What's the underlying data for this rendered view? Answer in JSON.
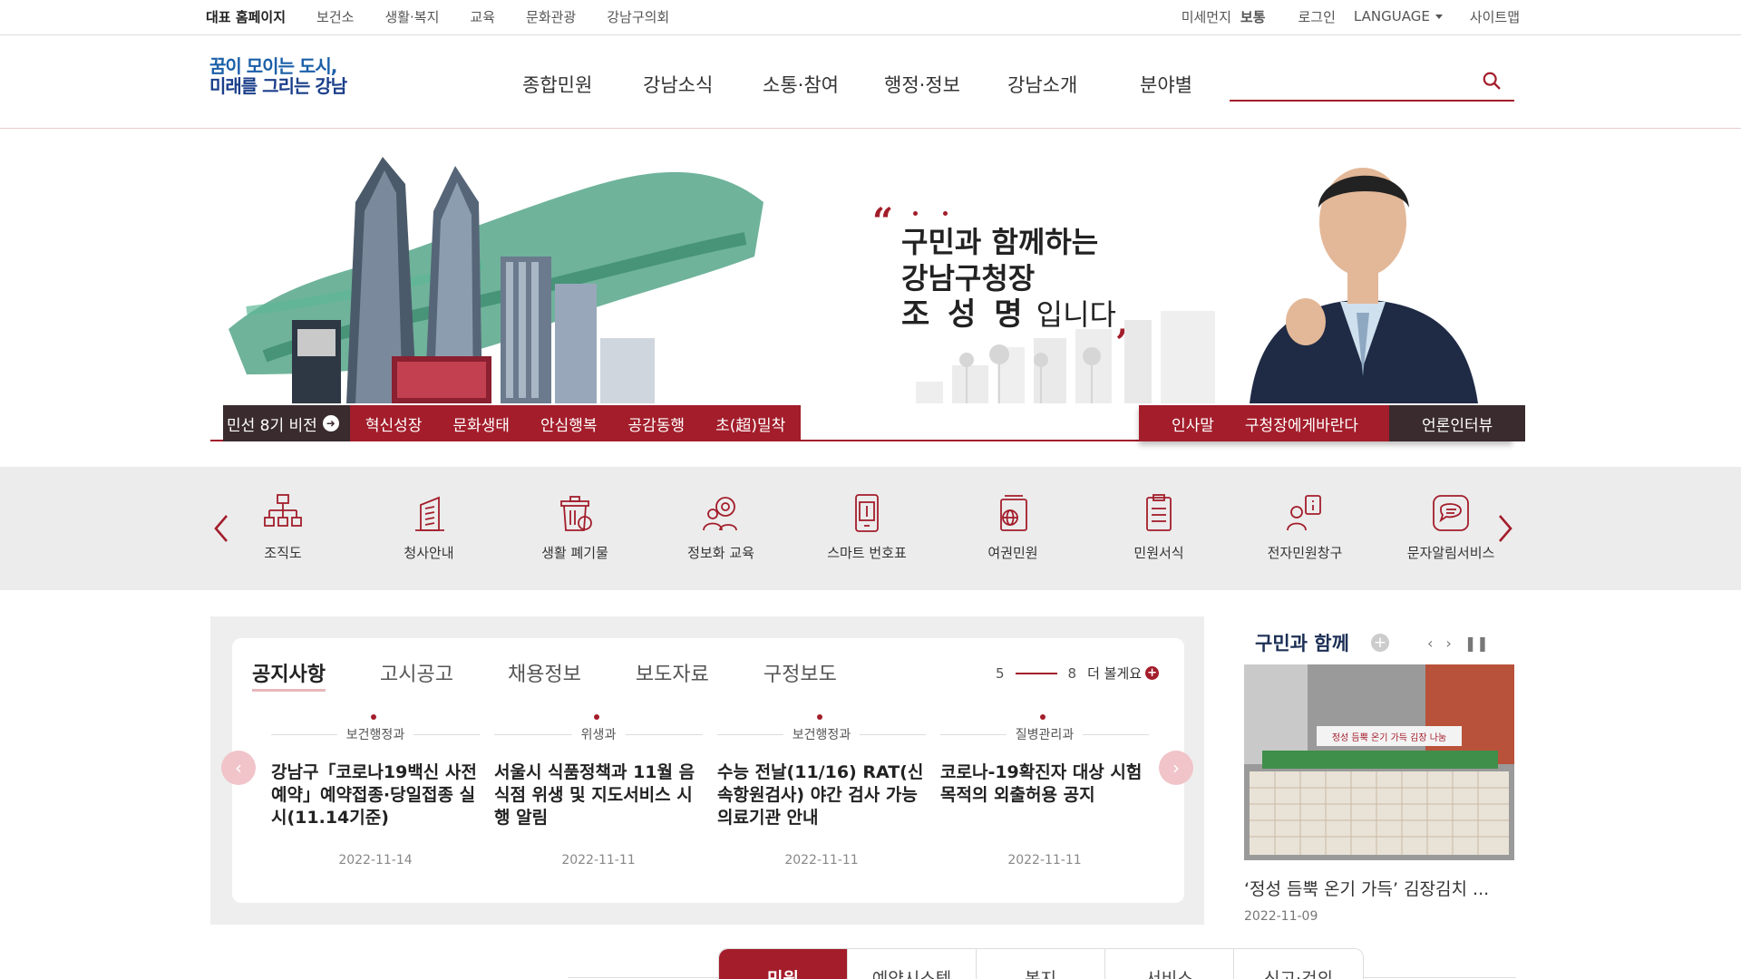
{
  "topbar": {
    "left_links": [
      "대표 홈페이지",
      "보건소",
      "생활·복지",
      "교육",
      "문화관광",
      "강남구의회"
    ],
    "dust_label": "미세먼지",
    "dust_value": "보통",
    "login": "로그인",
    "language": "LANGUAGE",
    "sitemap": "사이트맵"
  },
  "header": {
    "logo_line1": "꿈이 모이는 도시,",
    "logo_line2": "미래를 그리는 강남",
    "gnb": [
      "종합민원",
      "강남소식",
      "소통·참여",
      "행정·정보",
      "강남소개",
      "분야별"
    ],
    "search_placeholder": ""
  },
  "hero": {
    "quote_line1": "구민과 함께하는",
    "quote_line2": "강남구청장",
    "quote_name": "조 성 명",
    "quote_suffix": "입니다",
    "vision_first": "민선 8기 비전",
    "vision_items": [
      "혁신성장",
      "문화생태",
      "안심행복",
      "공감동행",
      "초(超)밀착"
    ],
    "mayor_links": [
      "인사말",
      "구청장에게바란다",
      "언론인터뷰"
    ]
  },
  "quick_menu": [
    {
      "label": "조직도",
      "icon": "org-chart-icon"
    },
    {
      "label": "청사안내",
      "icon": "building-icon"
    },
    {
      "label": "생활 폐기물",
      "icon": "trash-icon"
    },
    {
      "label": "정보화 교육",
      "icon": "gear-people-icon"
    },
    {
      "label": "스마트 번호표",
      "icon": "number-ticket-icon"
    },
    {
      "label": "여권민원",
      "icon": "passport-icon"
    },
    {
      "label": "민원서식",
      "icon": "form-icon"
    },
    {
      "label": "전자민원창구",
      "icon": "e-service-icon"
    },
    {
      "label": "문자알림서비스",
      "icon": "sms-icon"
    }
  ],
  "board": {
    "tabs": [
      "공지사항",
      "고시공고",
      "채용정보",
      "보도자료",
      "구정보도"
    ],
    "active_tab": 0,
    "page_current": "5",
    "page_total": "8",
    "more_label": "더 볼게요",
    "notices": [
      {
        "dept": "보건행정과",
        "title": "강남구「코로나19백신 사전예약」예약접종·당일접종 실시(11.14기준)",
        "date": "2022-11-14"
      },
      {
        "dept": "위생과",
        "title": "서울시 식품정책과 11월 음식점 위생 및 지도서비스 시행 알림",
        "date": "2022-11-11"
      },
      {
        "dept": "보건행정과",
        "title": "수능 전날(11/16) RAT(신속항원검사) 야간 검사 가능 의료기관 안내",
        "date": "2022-11-11"
      },
      {
        "dept": "질병관리과",
        "title": "코로나-19확진자 대상 시험목적의 외출허용 공지",
        "date": "2022-11-11"
      }
    ]
  },
  "together": {
    "title": "구민과 함께",
    "caption": "‘정성 듬뿍 온기 가득’ 김장김치 ...",
    "date": "2022-11-09",
    "banner_text": "정성 듬뿍 온기 가득 김장 나눔"
  },
  "bottom_tabs": [
    "민원",
    "예약시스템",
    "복지",
    "서비스",
    "신고·건의"
  ],
  "colors": {
    "accent": "#a31d2b",
    "dark": "#3a2b2e",
    "good": "#19a05a",
    "navy": "#1c2f55"
  }
}
